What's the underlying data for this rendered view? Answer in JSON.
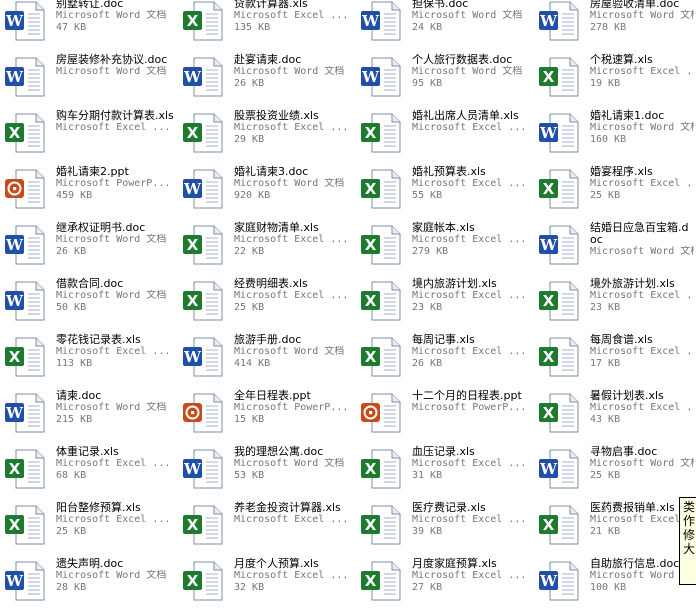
{
  "files": [
    {
      "name": "别墅转让.doc",
      "type": "Microsoft Word 文档",
      "size": "47 KB",
      "kind": "word"
    },
    {
      "name": "贷款计算器.xls",
      "type": "Microsoft Excel ...",
      "size": "135 KB",
      "kind": "excel"
    },
    {
      "name": "担保书.doc",
      "type": "Microsoft Word 文档",
      "size": "24 KB",
      "kind": "word"
    },
    {
      "name": "房屋验收清单.doc",
      "type": "Microsoft Word 文档",
      "size": "278 KB",
      "kind": "word"
    },
    {
      "name": "房屋装修补充协议.doc",
      "type": "Microsoft Word 文档",
      "size": "",
      "kind": "word"
    },
    {
      "name": "赴宴请柬.doc",
      "type": "Microsoft Word 文档",
      "size": "26 KB",
      "kind": "word"
    },
    {
      "name": "个人旅行数据表.doc",
      "type": "Microsoft Word 文档",
      "size": "95 KB",
      "kind": "word"
    },
    {
      "name": "个税速算.xls",
      "type": "Microsoft Excel ...",
      "size": "19 KB",
      "kind": "excel"
    },
    {
      "name": "购车分期付款计算表.xls",
      "type": "Microsoft Excel ...",
      "size": "",
      "kind": "excel"
    },
    {
      "name": "股票投资业绩.xls",
      "type": "Microsoft Excel ...",
      "size": "29 KB",
      "kind": "excel"
    },
    {
      "name": "婚礼出席人员清单.xls",
      "type": "Microsoft Excel ...",
      "size": "",
      "kind": "excel"
    },
    {
      "name": "婚礼请柬1.doc",
      "type": "Microsoft Word 文档",
      "size": "160 KB",
      "kind": "word"
    },
    {
      "name": "婚礼请柬2.ppt",
      "type": "Microsoft PowerP...",
      "size": "459 KB",
      "kind": "ppt"
    },
    {
      "name": "婚礼请柬3.doc",
      "type": "Microsoft Word 文档",
      "size": "920 KB",
      "kind": "word"
    },
    {
      "name": "婚礼预算表.xls",
      "type": "Microsoft Excel ...",
      "size": "55 KB",
      "kind": "excel"
    },
    {
      "name": "婚宴程序.xls",
      "type": "Microsoft Excel ...",
      "size": "25 KB",
      "kind": "excel"
    },
    {
      "name": "继承权证明书.doc",
      "type": "Microsoft Word 文档",
      "size": "26 KB",
      "kind": "word"
    },
    {
      "name": "家庭财物清单.xls",
      "type": "Microsoft Excel ...",
      "size": "22 KB",
      "kind": "excel"
    },
    {
      "name": "家庭帐本.xls",
      "type": "Microsoft Excel ...",
      "size": "279 KB",
      "kind": "excel"
    },
    {
      "name": "结婚日应急百宝箱.doc",
      "type": "Microsoft Word 文档",
      "size": "",
      "kind": "word"
    },
    {
      "name": "借款合同.doc",
      "type": "Microsoft Word 文档",
      "size": "50 KB",
      "kind": "word"
    },
    {
      "name": "经费明细表.xls",
      "type": "Microsoft Excel ...",
      "size": "25 KB",
      "kind": "excel"
    },
    {
      "name": "境内旅游计划.xls",
      "type": "Microsoft Excel ...",
      "size": "23 KB",
      "kind": "excel"
    },
    {
      "name": "境外旅游计划.xls",
      "type": "Microsoft Excel ...",
      "size": "23 KB",
      "kind": "excel"
    },
    {
      "name": "零花钱记录表.xls",
      "type": "Microsoft Excel ...",
      "size": "113 KB",
      "kind": "excel"
    },
    {
      "name": "旅游手册.doc",
      "type": "Microsoft Word 文档",
      "size": "414 KB",
      "kind": "word"
    },
    {
      "name": "每周记事.xls",
      "type": "Microsoft Excel ...",
      "size": "26 KB",
      "kind": "excel"
    },
    {
      "name": "每周食谱.xls",
      "type": "Microsoft Excel ...",
      "size": "17 KB",
      "kind": "excel"
    },
    {
      "name": "请柬.doc",
      "type": "Microsoft Word 文档",
      "size": "215 KB",
      "kind": "word"
    },
    {
      "name": "全年日程表.ppt",
      "type": "Microsoft PowerP...",
      "size": "15 KB",
      "kind": "ppt"
    },
    {
      "name": "十二个月的日程表.ppt",
      "type": "Microsoft PowerP...",
      "size": "",
      "kind": "ppt"
    },
    {
      "name": "暑假计划表.xls",
      "type": "Microsoft Excel ...",
      "size": "43 KB",
      "kind": "excel"
    },
    {
      "name": "体重记录.xls",
      "type": "Microsoft Excel ...",
      "size": "68 KB",
      "kind": "excel"
    },
    {
      "name": "我的理想公寓.doc",
      "type": "Microsoft Word 文档",
      "size": "53 KB",
      "kind": "word"
    },
    {
      "name": "血压记录.xls",
      "type": "Microsoft Excel ...",
      "size": "31 KB",
      "kind": "excel"
    },
    {
      "name": "寻物启事.doc",
      "type": "Microsoft Word 文档",
      "size": "25 KB",
      "kind": "word"
    },
    {
      "name": "阳台整修预算.xls",
      "type": "Microsoft Excel ...",
      "size": "25 KB",
      "kind": "excel"
    },
    {
      "name": "养老金投资计算器.xls",
      "type": "Microsoft Excel ...",
      "size": "",
      "kind": "excel"
    },
    {
      "name": "医疗费记录.xls",
      "type": "Microsoft Excel ...",
      "size": "39 KB",
      "kind": "excel"
    },
    {
      "name": "医药费报销单.xls",
      "type": "Microsoft Excel ...",
      "size": "21 KB",
      "kind": "excel"
    },
    {
      "name": "遗失声明.doc",
      "type": "Microsoft Word 文档",
      "size": "28 KB",
      "kind": "word"
    },
    {
      "name": "月度个人预算.xls",
      "type": "Microsoft Excel ...",
      "size": "32 KB",
      "kind": "excel"
    },
    {
      "name": "月度家庭预算.xls",
      "type": "Microsoft Excel ...",
      "size": "27 KB",
      "kind": "excel"
    },
    {
      "name": "自助旅行信息.doc",
      "type": "Microsoft Word 文档",
      "size": "100 KB",
      "kind": "word"
    }
  ],
  "tooltip": {
    "lines": [
      "类",
      "作",
      "修",
      "大"
    ]
  },
  "colors": {
    "word": "#1f4fa8",
    "excel": "#1e7a2e",
    "ppt": "#c84a17",
    "caption": "#777777"
  }
}
